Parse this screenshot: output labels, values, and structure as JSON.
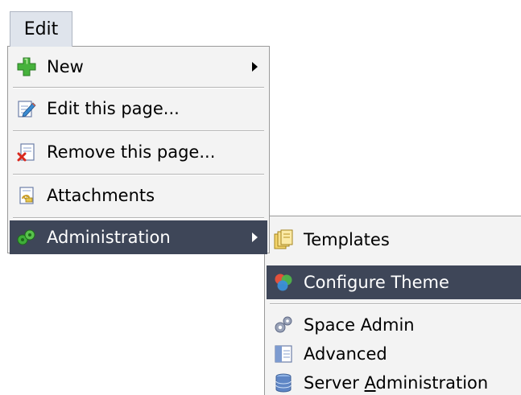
{
  "menu_bar": {
    "edit_label": "Edit"
  },
  "main_menu": {
    "items": [
      {
        "label": "New",
        "icon": "plus-icon",
        "has_submenu": true
      },
      {
        "label": "Edit this page...",
        "icon": "edit-page-icon",
        "has_submenu": false
      },
      {
        "label": "Remove this page...",
        "icon": "remove-page-icon",
        "has_submenu": false
      },
      {
        "label": "Attachments",
        "icon": "attachment-icon",
        "has_submenu": false
      },
      {
        "label": "Administration",
        "icon": "administration-icon",
        "has_submenu": true,
        "highlighted": true
      }
    ]
  },
  "admin_submenu": {
    "items": [
      {
        "label": "Templates",
        "icon": "templates-icon"
      },
      {
        "label": "Configure Theme",
        "icon": "theme-icon",
        "highlighted": true
      },
      {
        "label": "Space Admin",
        "icon": "gears-icon"
      },
      {
        "label": "Advanced",
        "icon": "advanced-icon"
      },
      {
        "label_before": "Server ",
        "label_mnemonic": "A",
        "label_after": "dministration",
        "icon": "server-icon"
      }
    ]
  },
  "colors": {
    "highlight": "#3e4658",
    "menu_background": "#f3f3f3",
    "tab_background": "#dfe4ec"
  }
}
